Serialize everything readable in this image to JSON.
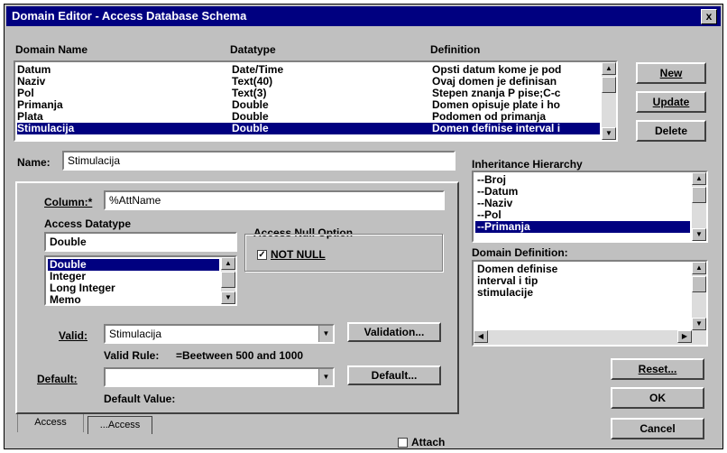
{
  "window": {
    "title": "Domain Editor - Access Database Schema",
    "close_glyph": "x"
  },
  "grid": {
    "columns": [
      "Domain Name",
      "Datatype",
      "Definition"
    ],
    "rows": [
      {
        "name": "Datum",
        "type": "Date/Time",
        "def": "Opsti datum kome je  pod"
      },
      {
        "name": "Naziv",
        "type": "Text(40)",
        "def": "Ovaj domen je  definisan"
      },
      {
        "name": "Pol",
        "type": "Text(3)",
        "def": "Stepen znanja  P pise;C-c"
      },
      {
        "name": "Primanja",
        "type": "Double",
        "def": "Domen opisuje plate  i ho"
      },
      {
        "name": "Plata",
        "type": "Double",
        "def": "Podomen od primanja"
      },
      {
        "name": "Stimulacija",
        "type": "Double",
        "def": "Domen definise  interval i"
      }
    ],
    "selected_index": 5
  },
  "buttons": {
    "new": "New",
    "update": "Update",
    "delete": "Delete",
    "validation": "Validation...",
    "default": "Default...",
    "reset": "Reset...",
    "ok": "OK",
    "cancel": "Cancel"
  },
  "name_field": {
    "label": "Name:",
    "value": "Stimulacija"
  },
  "column_field": {
    "label": "Column:*",
    "value": "%AttName"
  },
  "access_datatype": {
    "label": "Access Datatype",
    "value": "Double",
    "options": [
      "Double",
      "Integer",
      "Long Integer",
      "Memo"
    ],
    "selected_index": 0
  },
  "null_option": {
    "label": "Access Null Option",
    "checkbox_label": "NOT NULL",
    "checked": true
  },
  "valid": {
    "label": "Valid:",
    "value": "Stimulacija",
    "rule_label": "Valid Rule:",
    "rule_value": "=Beetween 500 and 1000"
  },
  "default": {
    "label": "Default:",
    "value": "",
    "value_label": "Default Value:"
  },
  "tabs": [
    "Access",
    "...Access"
  ],
  "inheritance": {
    "label": "Inheritance Hierarchy",
    "items": [
      "--Broj",
      "--Datum",
      "--Naziv",
      "--Pol",
      "--Primanja"
    ],
    "selected_index": 4
  },
  "domain_definition": {
    "label": "Domain Definition:",
    "lines": [
      "Domen definise",
      "interval i tip",
      "stimulacije"
    ]
  },
  "attach": {
    "label": "Attach",
    "checked": false
  }
}
